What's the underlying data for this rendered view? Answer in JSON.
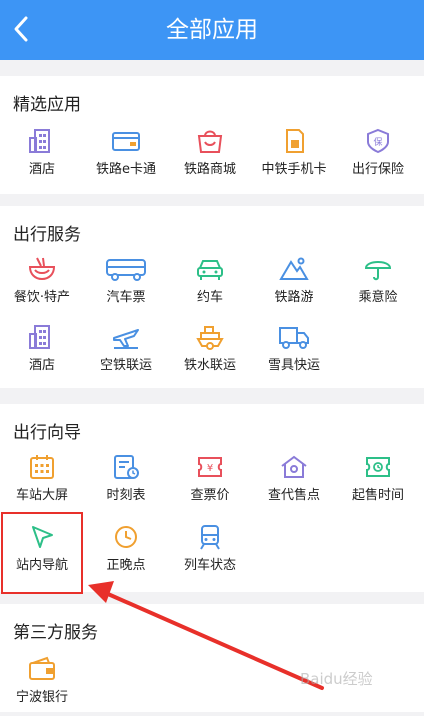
{
  "header": {
    "title": "全部应用"
  },
  "sections": [
    {
      "title": "精选应用",
      "items": [
        {
          "label": "酒店",
          "icon": "hotel-icon"
        },
        {
          "label": "铁路e卡通",
          "icon": "card-icon"
        },
        {
          "label": "铁路商城",
          "icon": "mall-icon"
        },
        {
          "label": "中铁手机卡",
          "icon": "sim-card-icon"
        },
        {
          "label": "出行保险",
          "icon": "insurance-icon"
        }
      ]
    },
    {
      "title": "出行服务",
      "items": [
        {
          "label": "餐饮·特产",
          "icon": "food-icon"
        },
        {
          "label": "汽车票",
          "icon": "bus-icon"
        },
        {
          "label": "约车",
          "icon": "car-icon"
        },
        {
          "label": "铁路游",
          "icon": "mountain-icon"
        },
        {
          "label": "乘意险",
          "icon": "umbrella-icon"
        },
        {
          "label": "酒店",
          "icon": "hotel-icon"
        },
        {
          "label": "空铁联运",
          "icon": "plane-train-icon"
        },
        {
          "label": "铁水联运",
          "icon": "ship-icon"
        },
        {
          "label": "雪具快运",
          "icon": "truck-icon"
        }
      ]
    },
    {
      "title": "出行向导",
      "items": [
        {
          "label": "车站大屏",
          "icon": "screen-calendar-icon"
        },
        {
          "label": "时刻表",
          "icon": "timetable-icon"
        },
        {
          "label": "查票价",
          "icon": "ticket-price-icon"
        },
        {
          "label": "查代售点",
          "icon": "agency-icon"
        },
        {
          "label": "起售时间",
          "icon": "sale-time-icon"
        },
        {
          "label": "站内导航",
          "icon": "navigation-icon"
        },
        {
          "label": "正晚点",
          "icon": "clock-icon"
        },
        {
          "label": "列车状态",
          "icon": "train-icon"
        }
      ]
    },
    {
      "title": "第三方服务",
      "items": [
        {
          "label": "宁波银行",
          "icon": "wallet-icon"
        }
      ]
    }
  ],
  "watermark": "Baidu经验",
  "colors": {
    "header": "#3d95f5",
    "highlight": "#e8302a",
    "blue": "#4a90e2",
    "purple": "#8a7bd8",
    "red": "#e8505b",
    "green": "#2dbf88",
    "orange": "#f0a030"
  }
}
